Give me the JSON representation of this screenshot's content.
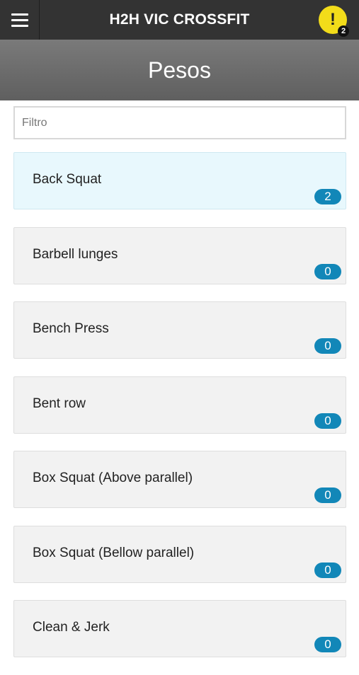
{
  "app": {
    "title": "H2H VIC CROSSFIT",
    "alert_icon": "!",
    "alert_count": "2"
  },
  "page": {
    "title": "Pesos"
  },
  "filter": {
    "placeholder": "Filtro",
    "value": ""
  },
  "colors": {
    "topbar": "#333333",
    "alert": "#f2dc1a",
    "badge": "#1287b8",
    "active_item": "#e8f8fd"
  },
  "items": [
    {
      "label": "Back Squat",
      "count": "2"
    },
    {
      "label": "Barbell lunges",
      "count": "0"
    },
    {
      "label": "Bench Press",
      "count": "0"
    },
    {
      "label": "Bent row",
      "count": "0"
    },
    {
      "label": "Box Squat (Above parallel)",
      "count": "0"
    },
    {
      "label": "Box Squat (Bellow parallel)",
      "count": "0"
    },
    {
      "label": "Clean & Jerk",
      "count": "0"
    }
  ]
}
